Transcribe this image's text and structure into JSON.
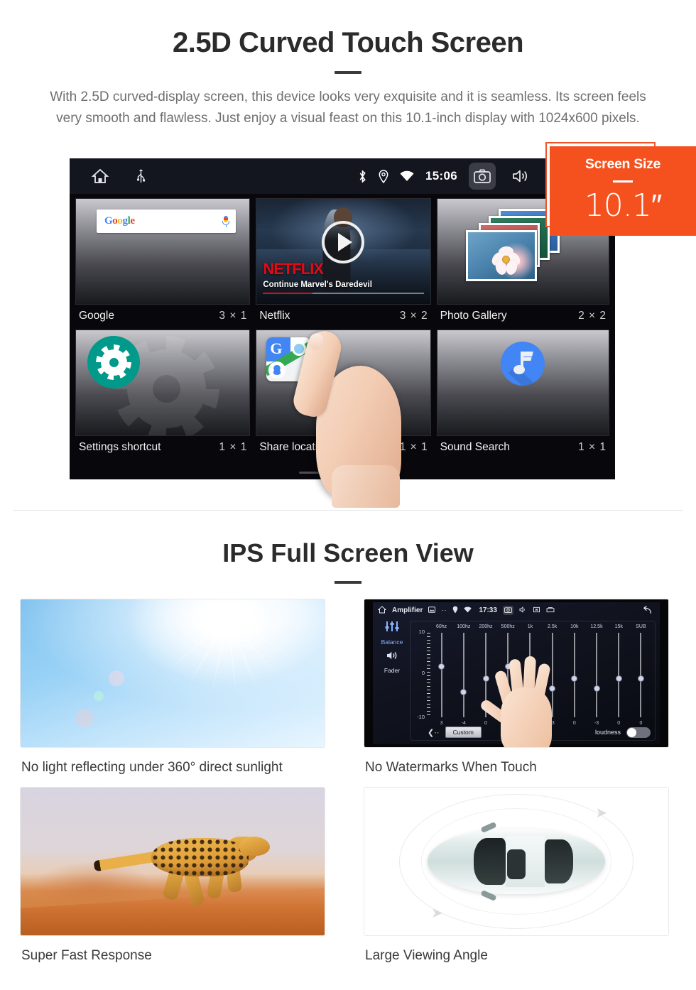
{
  "section1": {
    "title": "2.5D Curved Touch Screen",
    "description": "With 2.5D curved-display screen, this device looks very exquisite and it is seamless. Its screen feels very smooth and flawless. Just enjoy a visual feast on this 10.1-inch display with 1024x600 pixels."
  },
  "badge": {
    "label": "Screen Size",
    "value": "10.1″",
    "color": "#f4511e"
  },
  "android": {
    "statusbar": {
      "time": "15:06",
      "left_icons": [
        "home-icon",
        "usb-icon"
      ],
      "right_icons": [
        "bluetooth-icon",
        "location-icon",
        "wifi-icon",
        "camera-icon",
        "volume-icon",
        "close-icon",
        "recents-icon"
      ]
    },
    "widgets": [
      {
        "name": "Google",
        "size": "3 × 1",
        "icon": "google-search-widget"
      },
      {
        "name": "Netflix",
        "size": "3 × 2",
        "icon": "netflix-widget"
      },
      {
        "name": "Photo Gallery",
        "size": "2 × 2",
        "icon": "photo-gallery-widget"
      },
      {
        "name": "Settings shortcut",
        "size": "1 × 1",
        "icon": "gear-icon"
      },
      {
        "name": "Share location",
        "size": "1 × 1",
        "icon": "google-maps-icon"
      },
      {
        "name": "Sound Search",
        "size": "1 × 1",
        "icon": "music-note-icon"
      }
    ],
    "netflix": {
      "brand": "NETFLIX",
      "subtitle": "Continue Marvel's Daredevil"
    },
    "google": {
      "logo": "Google",
      "mic": "microphone-icon"
    },
    "page_indicator": {
      "count": 3,
      "active": 3
    }
  },
  "section2": {
    "title": "IPS Full Screen View",
    "cards": [
      {
        "caption": "No light reflecting under 360° direct sunlight",
        "image": "sunlight-sky"
      },
      {
        "caption": "No Watermarks When Touch",
        "image": "amplifier-equalizer-screen"
      },
      {
        "caption": "Super Fast Response",
        "image": "running-cheetah"
      },
      {
        "caption": "Large Viewing Angle",
        "image": "car-top-view"
      }
    ]
  },
  "amplifier": {
    "title": "Amplifier",
    "time": "17:33",
    "side": [
      "Balance",
      "Fader"
    ],
    "frequencies": [
      "60hz",
      "100hz",
      "200hz",
      "500hz",
      "1k",
      "2.5k",
      "10k",
      "12.5k",
      "15k",
      "SUB"
    ],
    "values": [
      "3",
      "-4",
      "0",
      "3",
      "0",
      "-3",
      "0",
      "-3",
      "0",
      "0"
    ],
    "scale": {
      "max": "10",
      "zero": "0",
      "min": "-10"
    },
    "preset": "Custom",
    "loudness_label": "loudness",
    "loudness_on": false,
    "back_arrow": "back-arrow-icon"
  }
}
